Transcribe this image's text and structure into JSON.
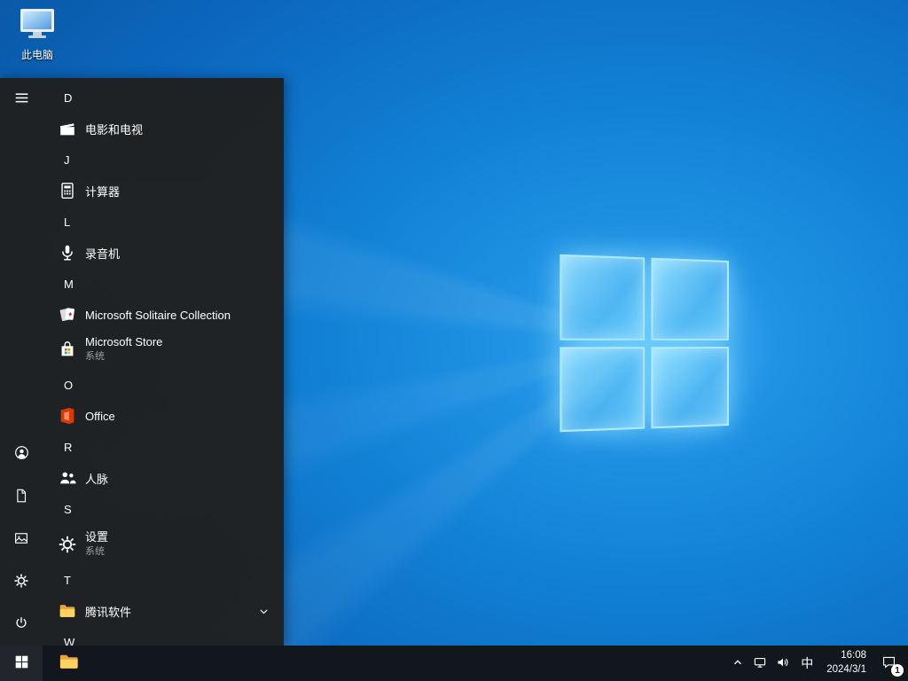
{
  "desktop": {
    "this_pc_label": "此电脑"
  },
  "start_menu": {
    "sections": [
      {
        "letter": "D",
        "apps": [
          {
            "label": "电影和电视",
            "icon": "movies-tv-icon"
          }
        ]
      },
      {
        "letter": "J",
        "apps": [
          {
            "label": "计算器",
            "icon": "calculator-icon"
          }
        ]
      },
      {
        "letter": "L",
        "apps": [
          {
            "label": "录音机",
            "icon": "voice-recorder-icon"
          }
        ]
      },
      {
        "letter": "M",
        "apps": [
          {
            "label": "Microsoft Solitaire Collection",
            "icon": "solitaire-icon"
          },
          {
            "label": "Microsoft Store",
            "sublabel": "系统",
            "icon": "store-icon"
          }
        ]
      },
      {
        "letter": "O",
        "apps": [
          {
            "label": "Office",
            "icon": "office-icon"
          }
        ]
      },
      {
        "letter": "R",
        "apps": [
          {
            "label": "人脉",
            "icon": "people-icon"
          }
        ]
      },
      {
        "letter": "S",
        "apps": [
          {
            "label": "设置",
            "sublabel": "系统",
            "icon": "gear-icon"
          }
        ]
      },
      {
        "letter": "T",
        "apps": [
          {
            "label": "腾讯软件",
            "icon": "folder-icon",
            "expand_icon": "chevron-down-icon"
          }
        ]
      },
      {
        "letter": "W",
        "apps": []
      }
    ]
  },
  "taskbar": {
    "ime_indicator": "中",
    "clock": {
      "time": "16:08",
      "date": "2024/3/1"
    },
    "notification_badge": "1"
  },
  "colors": {
    "taskbar_bg": "#12161d",
    "start_menu_bg": "#202020",
    "wallpaper_blue": "#0b67bd",
    "logo_glow": "#7dd7ff",
    "folder_yellow": "#ffd261",
    "office_orange": "#d83b01",
    "store_tile_colors": [
      "#f25022",
      "#7fba00",
      "#00a4ef",
      "#ffb900"
    ]
  }
}
